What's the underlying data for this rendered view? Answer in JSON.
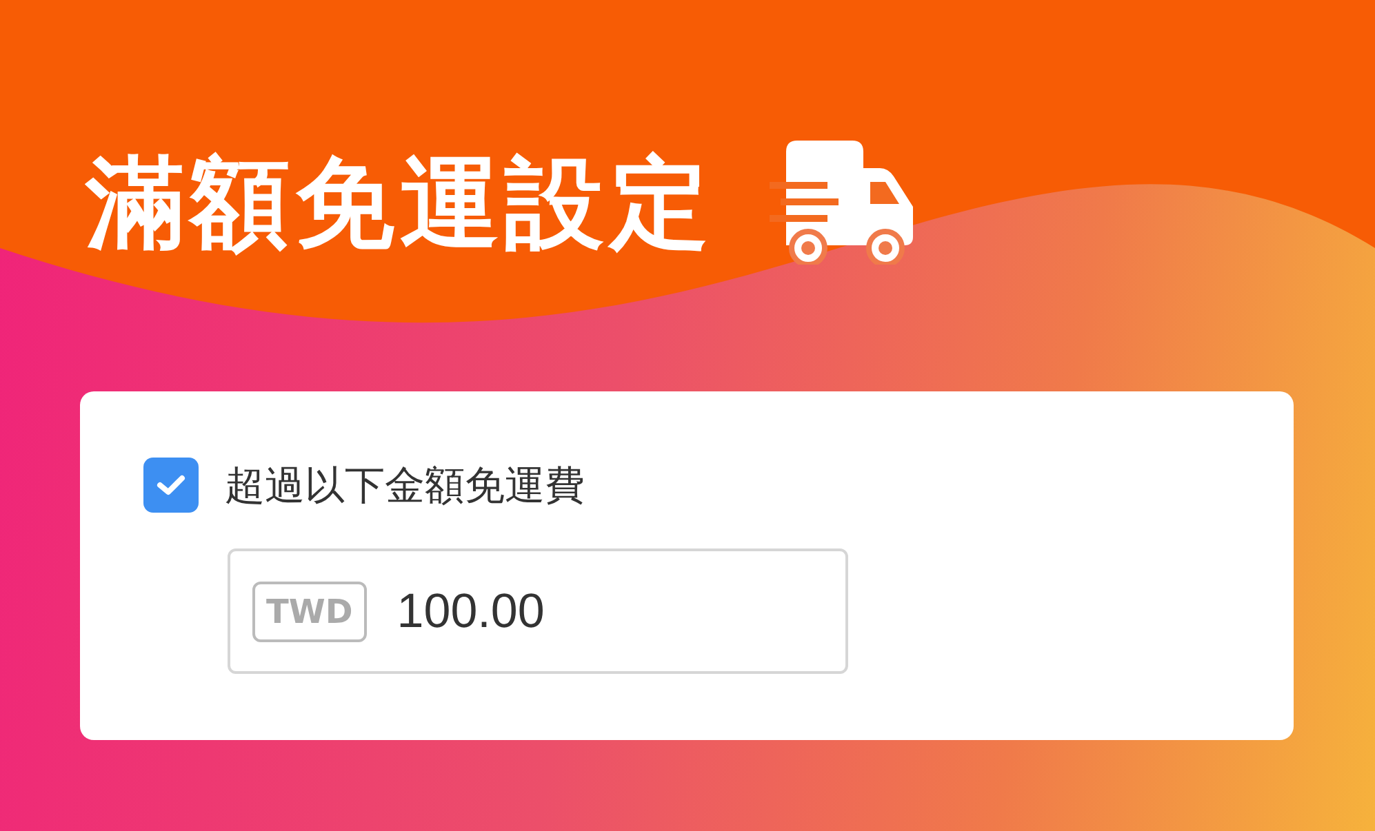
{
  "title": "滿額免運設定",
  "free_shipping": {
    "label": "超過以下金額免運費",
    "checked": true,
    "currency": "TWD",
    "amount": "100.00"
  }
}
